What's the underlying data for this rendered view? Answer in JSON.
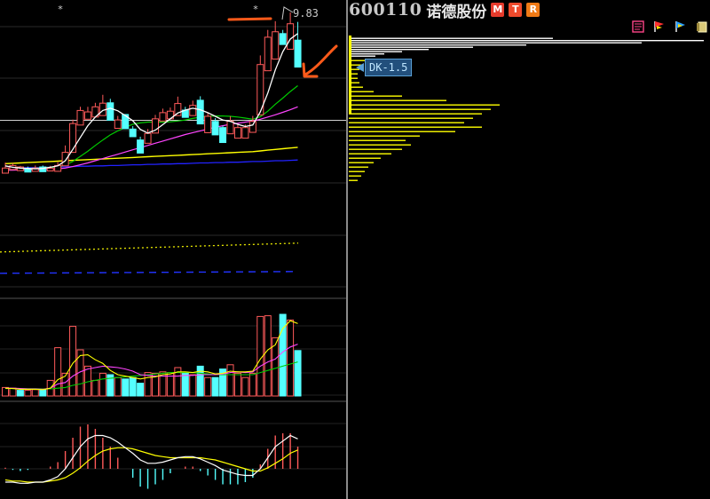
{
  "header": {
    "stock_code": "600110",
    "stock_name": "诺德股份",
    "badges": [
      "M",
      "T",
      "R"
    ]
  },
  "chart": {
    "max_price_label": "9.83",
    "star_markers": [
      "*",
      "*"
    ],
    "dk_label": "DK-1.5",
    "colors": {
      "up_candle": "#ff5a5a",
      "down_candle": "#54ffff",
      "ma5": "#ffffff",
      "ma10": "#ffff00",
      "ma20": "#ff44ff",
      "ma60": "#00cc00",
      "long_ma": "#2222ff",
      "annotation": "#ff5a1a",
      "profile": "#ffff00",
      "profile_top": "#ffffff"
    }
  },
  "toolbar": {
    "icons": [
      "chart-list-icon",
      "flag-icon",
      "pin-icon",
      "book-icon"
    ]
  },
  "chart_data": {
    "type": "candlestick",
    "candles": [
      [
        5.56,
        5.71,
        5.44,
        5.42,
        "up"
      ],
      [
        5.63,
        5.69,
        5.6,
        5.52,
        "up"
      ],
      [
        5.59,
        5.62,
        5.53,
        5.49,
        "up"
      ],
      [
        5.55,
        5.6,
        5.47,
        5.45,
        "down"
      ],
      [
        5.56,
        5.63,
        5.51,
        5.47,
        "up"
      ],
      [
        5.59,
        5.63,
        5.52,
        5.46,
        "down"
      ],
      [
        5.55,
        5.62,
        5.5,
        5.48,
        "up"
      ],
      [
        5.63,
        5.72,
        5.5,
        5.47,
        "up"
      ],
      [
        5.99,
        6.18,
        5.66,
        5.62,
        "up"
      ],
      [
        6.78,
        6.89,
        6.09,
        5.99,
        "up"
      ],
      [
        7.14,
        7.24,
        6.79,
        6.74,
        "up"
      ],
      [
        7.1,
        7.24,
        6.96,
        6.9,
        "up"
      ],
      [
        7.24,
        7.35,
        7.04,
        6.96,
        "up"
      ],
      [
        7.34,
        7.57,
        7.1,
        7.0,
        "up"
      ],
      [
        7.35,
        7.46,
        7.03,
        6.87,
        "down"
      ],
      [
        6.88,
        6.99,
        6.75,
        6.65,
        "up"
      ],
      [
        7.03,
        7.04,
        6.74,
        6.64,
        "down"
      ],
      [
        6.63,
        6.71,
        6.53,
        6.42,
        "down"
      ],
      [
        6.33,
        6.42,
        6.07,
        5.97,
        "down"
      ],
      [
        6.51,
        6.63,
        6.33,
        6.24,
        "up"
      ],
      [
        6.91,
        7.02,
        6.6,
        6.52,
        "up"
      ],
      [
        7.08,
        7.19,
        6.98,
        6.85,
        "up"
      ],
      [
        7.12,
        7.22,
        7.01,
        6.91,
        "up"
      ],
      [
        7.33,
        7.52,
        7.05,
        7.0,
        "up"
      ],
      [
        7.15,
        7.24,
        7.07,
        6.95,
        "down"
      ],
      [
        7.28,
        7.41,
        7.09,
        7.0,
        "up"
      ],
      [
        7.42,
        7.53,
        6.84,
        6.77,
        "down"
      ],
      [
        6.98,
        7.07,
        6.63,
        6.53,
        "up"
      ],
      [
        6.84,
        6.93,
        6.55,
        6.47,
        "down"
      ],
      [
        6.67,
        6.72,
        6.36,
        6.26,
        "down"
      ],
      [
        6.85,
        6.98,
        6.6,
        6.5,
        "up"
      ],
      [
        6.67,
        6.75,
        6.49,
        6.38,
        "up"
      ],
      [
        6.67,
        6.75,
        6.49,
        6.38,
        "up"
      ],
      [
        6.84,
        6.99,
        6.67,
        6.54,
        "up"
      ],
      [
        8.4,
        8.65,
        7.12,
        7.02,
        "up"
      ],
      [
        9.15,
        9.35,
        8.33,
        8.23,
        "up"
      ],
      [
        9.3,
        9.59,
        8.65,
        8.55,
        "up"
      ],
      [
        9.25,
        9.35,
        9.02,
        8.95,
        "down"
      ],
      [
        9.52,
        9.83,
        8.92,
        8.82,
        "up"
      ],
      [
        9.07,
        9.57,
        8.43,
        8.33,
        "down"
      ]
    ],
    "ma5": [
      5.62,
      5.58,
      5.56,
      5.55,
      5.54,
      5.55,
      5.58,
      5.62,
      5.76,
      6.07,
      6.4,
      6.72,
      6.96,
      7.14,
      7.2,
      7.13,
      7.0,
      6.86,
      6.62,
      6.52,
      6.6,
      6.75,
      6.91,
      7.07,
      7.15,
      7.2,
      7.16,
      7.08,
      6.98,
      6.88,
      6.84,
      6.76,
      6.7,
      6.74,
      7.1,
      7.62,
      8.25,
      8.75,
      9.1,
      9.25
    ],
    "ma10": [
      5.52,
      5.53,
      5.54,
      5.55,
      5.56,
      5.57,
      5.58,
      5.59,
      5.64,
      5.74,
      5.88,
      6.02,
      6.18,
      6.33,
      6.47,
      6.58,
      6.68,
      6.76,
      6.8,
      6.82,
      6.82,
      6.82,
      6.83,
      6.85,
      6.88,
      6.92,
      6.96,
      6.98,
      6.99,
      6.99,
      6.98,
      6.96,
      6.93,
      6.9,
      6.97,
      7.12,
      7.31,
      7.48,
      7.66,
      7.82
    ],
    "ma20": [
      5.5,
      5.5,
      5.51,
      5.51,
      5.52,
      5.52,
      5.53,
      5.54,
      5.56,
      5.6,
      5.65,
      5.7,
      5.76,
      5.82,
      5.88,
      5.94,
      6.0,
      6.06,
      6.12,
      6.18,
      6.24,
      6.3,
      6.36,
      6.42,
      6.48,
      6.53,
      6.58,
      6.63,
      6.68,
      6.72,
      6.76,
      6.79,
      6.82,
      6.85,
      6.9,
      6.96,
      7.02,
      7.09,
      7.16,
      7.24
    ],
    "ma60": [
      5.68,
      5.69,
      5.7,
      5.71,
      5.72,
      5.73,
      5.74,
      5.75,
      5.76,
      5.77,
      5.78,
      5.79,
      5.8,
      5.81,
      5.82,
      5.83,
      5.84,
      5.85,
      5.86,
      5.87,
      5.88,
      5.89,
      5.9,
      5.91,
      5.92,
      5.93,
      5.94,
      5.95,
      5.96,
      5.97,
      5.98,
      5.99,
      6.0,
      6.01,
      6.03,
      6.05,
      6.07,
      6.09,
      6.11,
      6.13
    ],
    "ma_long": [
      5.55,
      5.56,
      5.56,
      5.57,
      5.57,
      5.58,
      5.58,
      5.59,
      5.59,
      5.6,
      5.61,
      5.61,
      5.62,
      5.62,
      5.63,
      5.63,
      5.64,
      5.65,
      5.65,
      5.66,
      5.66,
      5.67,
      5.67,
      5.68,
      5.68,
      5.69,
      5.7,
      5.7,
      5.71,
      5.71,
      5.72,
      5.72,
      5.73,
      5.74,
      5.74,
      5.75,
      5.76,
      5.76,
      5.77,
      5.78
    ],
    "volume": [
      [
        1.2,
        "up"
      ],
      [
        1.1,
        "up"
      ],
      [
        0.8,
        "down"
      ],
      [
        0.8,
        "up"
      ],
      [
        0.9,
        "up"
      ],
      [
        1.0,
        "down"
      ],
      [
        2.2,
        "up"
      ],
      [
        6.8,
        "up"
      ],
      [
        3.2,
        "up"
      ],
      [
        9.8,
        "up"
      ],
      [
        6.5,
        "up"
      ],
      [
        4.2,
        "up"
      ],
      [
        2.2,
        "up"
      ],
      [
        3.2,
        "up"
      ],
      [
        3.0,
        "down"
      ],
      [
        2.6,
        "up"
      ],
      [
        2.4,
        "down"
      ],
      [
        2.6,
        "down"
      ],
      [
        1.8,
        "down"
      ],
      [
        3.3,
        "up"
      ],
      [
        3.2,
        "up"
      ],
      [
        3.4,
        "up"
      ],
      [
        3.3,
        "up"
      ],
      [
        4.0,
        "up"
      ],
      [
        3.2,
        "down"
      ],
      [
        3.0,
        "up"
      ],
      [
        4.2,
        "down"
      ],
      [
        2.6,
        "up"
      ],
      [
        2.6,
        "down"
      ],
      [
        3.8,
        "down"
      ],
      [
        4.4,
        "up"
      ],
      [
        3.2,
        "up"
      ],
      [
        2.6,
        "up"
      ],
      [
        3.2,
        "up"
      ],
      [
        11.2,
        "up"
      ],
      [
        11.3,
        "up"
      ],
      [
        8.2,
        "up"
      ],
      [
        11.5,
        "down"
      ],
      [
        10.7,
        "up"
      ],
      [
        6.4,
        "down"
      ]
    ],
    "vol_ma5": [
      1.1,
      1.05,
      0.95,
      0.95,
      0.95,
      0.9,
      1.1,
      2.3,
      2.8,
      4.6,
      5.7,
      5.8,
      5.1,
      4.6,
      3.6,
      3.0,
      2.8,
      2.6,
      2.4,
      2.6,
      2.7,
      3.0,
      3.1,
      3.4,
      3.4,
      3.3,
      3.5,
      3.4,
      3.1,
      3.2,
      3.5,
      3.4,
      3.4,
      3.5,
      5.2,
      6.5,
      7.2,
      9.5,
      10.6,
      10.2
    ],
    "vol_ma10": [
      1.1,
      1.1,
      1.05,
      1.0,
      1.0,
      0.95,
      1.1,
      1.7,
      1.9,
      2.8,
      3.4,
      3.8,
      4.0,
      4.2,
      4.1,
      4.0,
      3.8,
      3.5,
      3.0,
      2.9,
      2.8,
      2.8,
      2.8,
      2.8,
      2.9,
      2.9,
      3.0,
      3.0,
      3.0,
      3.1,
      3.3,
      3.4,
      3.3,
      3.4,
      4.2,
      4.8,
      5.2,
      6.2,
      6.9,
      7.3
    ],
    "vol_ma20": [
      1.05,
      1.05,
      1.04,
      1.03,
      1.02,
      1.0,
      1.0,
      1.1,
      1.2,
      1.5,
      1.7,
      2.0,
      2.2,
      2.4,
      2.5,
      2.6,
      2.7,
      2.8,
      2.9,
      3.0,
      3.1,
      3.2,
      3.3,
      3.3,
      3.3,
      3.3,
      3.2,
      3.1,
      3.0,
      3.0,
      3.0,
      3.0,
      3.0,
      3.0,
      3.3,
      3.6,
      3.9,
      4.2,
      4.5,
      4.8
    ],
    "macd_dif": [
      -0.12,
      -0.12,
      -0.13,
      -0.13,
      -0.12,
      -0.12,
      -0.1,
      -0.07,
      0.0,
      0.1,
      0.2,
      0.27,
      0.3,
      0.3,
      0.28,
      0.24,
      0.19,
      0.14,
      0.08,
      0.05,
      0.05,
      0.06,
      0.08,
      0.1,
      0.11,
      0.11,
      0.09,
      0.06,
      0.03,
      -0.01,
      -0.03,
      -0.05,
      -0.06,
      -0.06,
      0.0,
      0.1,
      0.2,
      0.25,
      0.3,
      0.27
    ],
    "macd_dea": [
      -0.1,
      -0.11,
      -0.11,
      -0.12,
      -0.12,
      -0.12,
      -0.11,
      -0.1,
      -0.08,
      -0.04,
      0.01,
      0.07,
      0.12,
      0.16,
      0.18,
      0.19,
      0.19,
      0.18,
      0.16,
      0.14,
      0.12,
      0.11,
      0.1,
      0.1,
      0.1,
      0.1,
      0.1,
      0.09,
      0.08,
      0.06,
      0.04,
      0.02,
      0.0,
      -0.02,
      -0.02,
      0.01,
      0.05,
      0.09,
      0.14,
      0.17
    ],
    "macd_hist": [
      0.01,
      -0.01,
      -0.02,
      -0.01,
      0.0,
      0.0,
      0.02,
      0.06,
      0.16,
      0.28,
      0.38,
      0.4,
      0.36,
      0.28,
      0.2,
      0.1,
      0.0,
      -0.08,
      -0.16,
      -0.18,
      -0.14,
      -0.1,
      -0.04,
      0.0,
      0.02,
      0.02,
      -0.02,
      -0.06,
      -0.1,
      -0.14,
      -0.14,
      -0.14,
      -0.12,
      -0.08,
      0.04,
      0.18,
      0.3,
      0.32,
      0.32,
      0.2
    ],
    "dotted_line": [
      3.2,
      3.45
    ],
    "dashed_line": [
      2.6,
      2.65
    ],
    "profile_bins": [
      {
        "price": 9.7,
        "width": 230,
        "top": true
      },
      {
        "price": 9.65,
        "width": 400,
        "top": true
      },
      {
        "price": 9.6,
        "width": 330,
        "top": true
      },
      {
        "price": 9.55,
        "width": 200,
        "top": true
      },
      {
        "price": 9.5,
        "width": 140,
        "top": true
      },
      {
        "price": 9.45,
        "width": 90,
        "top": true
      },
      {
        "price": 9.4,
        "width": 60,
        "top": true
      },
      {
        "price": 9.35,
        "width": 40,
        "top": true
      },
      {
        "price": 9.3,
        "width": 30,
        "top": true
      },
      {
        "price": 9.2,
        "width": 20
      },
      {
        "price": 9.1,
        "width": 14
      },
      {
        "price": 9.0,
        "width": 12
      },
      {
        "price": 8.9,
        "width": 10
      },
      {
        "price": 8.8,
        "width": 10
      },
      {
        "price": 8.7,
        "width": 12
      },
      {
        "price": 8.6,
        "width": 16
      },
      {
        "price": 8.5,
        "width": 28
      },
      {
        "price": 8.4,
        "width": 60
      },
      {
        "price": 8.3,
        "width": 110
      },
      {
        "price": 8.2,
        "width": 170
      },
      {
        "price": 8.1,
        "width": 160
      },
      {
        "price": 8.0,
        "width": 150
      },
      {
        "price": 7.9,
        "width": 140
      },
      {
        "price": 7.8,
        "width": 130
      },
      {
        "price": 7.7,
        "width": 150
      },
      {
        "price": 7.6,
        "width": 120
      },
      {
        "price": 7.5,
        "width": 80
      },
      {
        "price": 7.4,
        "width": 64
      },
      {
        "price": 7.3,
        "width": 70
      },
      {
        "price": 7.2,
        "width": 60
      },
      {
        "price": 7.1,
        "width": 48
      },
      {
        "price": 7.0,
        "width": 36
      },
      {
        "price": 6.9,
        "width": 28
      },
      {
        "price": 6.8,
        "width": 22
      },
      {
        "price": 6.7,
        "width": 18
      },
      {
        "price": 6.6,
        "width": 14
      },
      {
        "price": 6.5,
        "width": 10
      }
    ]
  }
}
